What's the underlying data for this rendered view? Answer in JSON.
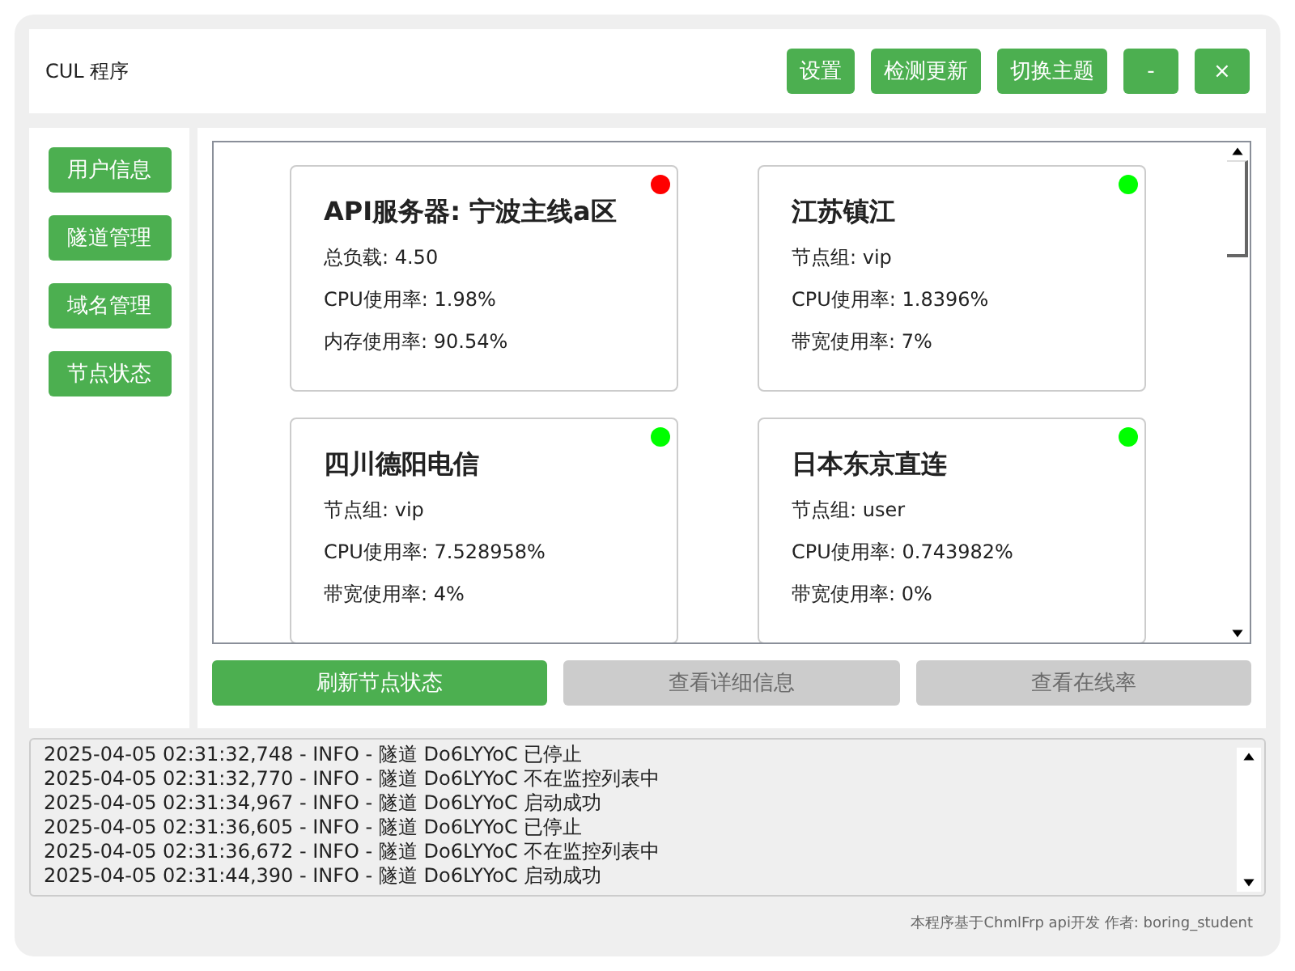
{
  "window": {
    "title": "CUL 程序"
  },
  "header_buttons": [
    "设置",
    "检测更新",
    "切换主题",
    "-",
    "×"
  ],
  "sidebar": {
    "items": [
      {
        "label": "用户信息"
      },
      {
        "label": "隧道管理"
      },
      {
        "label": "域名管理"
      },
      {
        "label": "节点状态"
      }
    ]
  },
  "nodes": [
    {
      "name": "API服务器: 宁波主线a区",
      "color": "#ff0000",
      "lines": [
        "总负载: 4.50",
        "CPU使用率: 1.98%",
        "内存使用率: 90.54%"
      ]
    },
    {
      "name": "江苏镇江",
      "color": "#00ff00",
      "lines": [
        "节点组: vip",
        "CPU使用率: 1.8396%",
        "带宽使用率: 7%"
      ]
    },
    {
      "name": "四川德阳电信",
      "color": "#00ff00",
      "lines": [
        "节点组: vip",
        "CPU使用率: 7.528958%",
        "带宽使用率: 4%"
      ]
    },
    {
      "name": "日本东京直连",
      "color": "#00ff00",
      "lines": [
        "节点组: user",
        "CPU使用率: 0.743982%",
        "带宽使用率: 0%"
      ]
    }
  ],
  "actions": [
    {
      "label": "刷新节点状态",
      "disabled": false
    },
    {
      "label": "查看详细信息",
      "disabled": true
    },
    {
      "label": "查看在线率",
      "disabled": true
    }
  ],
  "log": [
    "2025-04-05 02:31:32,748 - INFO - 隧道 Do6LYYoC 已停止",
    "2025-04-05 02:31:32,770 - INFO - 隧道 Do6LYYoC 不在监控列表中",
    "2025-04-05 02:31:34,967 - INFO - 隧道 Do6LYYoC 启动成功",
    "2025-04-05 02:31:36,605 - INFO - 隧道 Do6LYYoC 已停止",
    "2025-04-05 02:31:36,672 - INFO - 隧道 Do6LYYoC 不在监控列表中",
    "2025-04-05 02:31:44,390 - INFO - 隧道 Do6LYYoC 启动成功"
  ],
  "footer": "本程序基于ChmlFrp api开发 作者: boring_student"
}
